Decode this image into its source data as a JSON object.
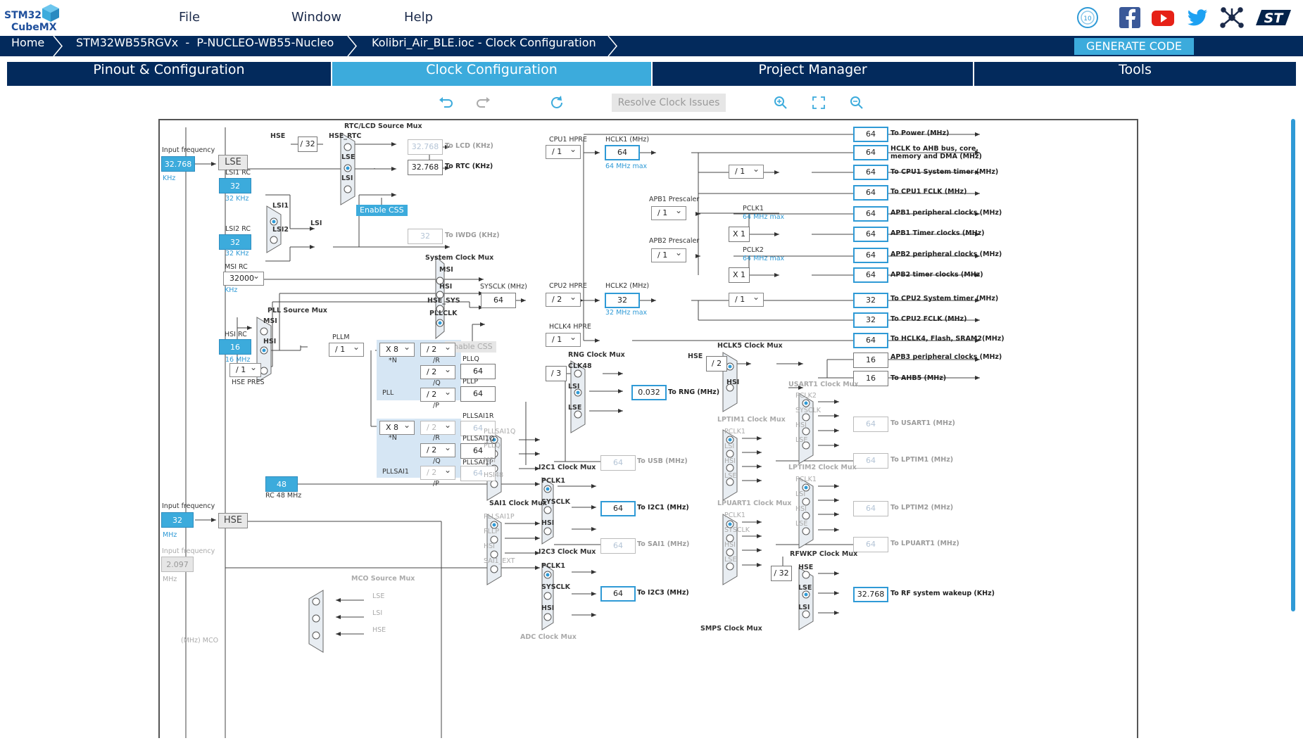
{
  "app": {
    "logo_top": "STM32",
    "logo_bottom": "CubeMX"
  },
  "menu": {
    "file": "File",
    "window": "Window",
    "help": "Help"
  },
  "social": [
    "anniversary-badge-icon",
    "facebook-icon",
    "youtube-icon",
    "twitter-icon",
    "network-icon",
    "st-logo-icon"
  ],
  "breadcrumb": {
    "home": "Home",
    "mcu": "STM32WB55RGVx",
    "board": "P-NUCLEO-WB55-Nucleo",
    "file": "Kolibri_Air_BLE.ioc - Clock Configuration"
  },
  "generate_code": "GENERATE CODE",
  "tabs": {
    "pinout": "Pinout & Configuration",
    "clock": "Clock Configuration",
    "project": "Project Manager",
    "tools": "Tools"
  },
  "toolbar": {
    "resolve": "Resolve Clock Issues"
  },
  "diagram": {
    "input_freq_label": "Input frequency",
    "lse_value": "32.768",
    "lse_unit": "KHz",
    "lse_btn": "LSE",
    "lsi1_rc": "LSI1 RC",
    "lsi1_value": "32",
    "lsi1_unit": "32 KHz",
    "lsi2_rc": "LSI2 RC",
    "lsi2_value": "32",
    "lsi2_unit": "32 KHz",
    "lsi1": "LSI1",
    "lsi2": "LSI2",
    "lsi": "LSI",
    "rtc_mux_title": "RTC/LCD Source Mux",
    "hse": "HSE",
    "hse_div": "/ 32",
    "hse_rtc": "HSE_RTC",
    "lse": "LSE",
    "lcd_value": "32.768",
    "lcd_label": "To LCD (KHz)",
    "rtc_value": "32.768",
    "rtc_label": "To RTC (KHz)",
    "enable_css": "Enable CSS",
    "iwdg_value": "32",
    "iwdg_label": "To IWDG (KHz)",
    "msi_rc": "MSI RC",
    "msi_value": "32000",
    "msi_unit": "KHz",
    "sysclk_mux_title": "System Clock Mux",
    "msi": "MSI",
    "hsi": "HSI",
    "hse_sys": "HSE_SYS",
    "pllclk": "PLLCLK",
    "sysclk_label": "SYSCLK (MHz)",
    "sysclk_value": "64",
    "pll_source_mux": "PLL Source Mux",
    "hsi_rc": "HSI RC",
    "hsi_value": "16",
    "hsi_unit": "16 MHz",
    "hse_pres_value": "/ 1",
    "hse_pres": "HSE PRES",
    "pllm": "PLLM",
    "pllm_value": "/ 1",
    "pll_n_value": "X 8",
    "pll_n": "*N",
    "pll_r_value": "/ 2",
    "pll_r": "/R",
    "pll_q_value": "/ 2",
    "pll_q": "/Q",
    "pll_p_value": "/ 2",
    "pll_p": "/P",
    "pll": "PLL",
    "pllq": "PLLQ",
    "pllq_value": "64",
    "pllp": "PLLP",
    "pllp_value": "64",
    "sai_n_value": "X 8",
    "sai_r_value": "/ 2",
    "sai_q_value": "/ 2",
    "sai_p_value": "/ 2",
    "pllsai1": "PLLSAI1",
    "pllsai1r": "PLLSAI1R",
    "pllsai1r_value": "64",
    "pllsai1q": "PLLSAI1Q",
    "pllsai1q_value": "64",
    "pllsai1p": "PLLSAI1P",
    "pllsai1p_value": "64",
    "rc48_value": "48",
    "rc48": "RC 48 MHz",
    "hse_input_value": "32",
    "hse_unit": "MHz",
    "hse_btn": "HSE",
    "ext_input_label": "Input frequency",
    "ext_value": "2.097",
    "ext_unit": "MHz",
    "mco_mux": "MCO Source Mux",
    "cpu1_hpre": "CPU1 HPRE",
    "cpu1_hpre_value": "/ 1",
    "hclk1": "HCLK1 (MHz)",
    "hclk1_value": "64",
    "hclk1_max": "64 MHz max",
    "apb1_prescaler": "APB1 Prescaler",
    "apb1_value": "/ 1",
    "pclk1": "PCLK1",
    "pclk1_max": "64 MHz max",
    "x1": "X 1",
    "apb2_prescaler": "APB2 Prescaler",
    "apb2_value": "/ 1",
    "pclk2": "PCLK2",
    "pclk2_max": "64 MHz max",
    "sys_timer_div": "/ 1",
    "cpu2_hpre": "CPU2 HPRE",
    "cpu2_hpre_value": "/ 2",
    "hclk2": "HCLK2 (MHz)",
    "hclk2_value": "32",
    "hclk2_max": "32 MHz max",
    "cpu2_timer_div": "/ 1",
    "hclk4_hpre": "HCLK4 HPRE",
    "hclk4_value": "/ 1",
    "outputs": [
      {
        "value": "64",
        "label": "To Power (MHz)"
      },
      {
        "value": "64",
        "label": "HCLK to AHB bus, core,",
        "label2": "memory and DMA (MHz)"
      },
      {
        "value": "64",
        "label": "To CPU1 System timer (MHz)"
      },
      {
        "value": "64",
        "label": "To CPU1 FCLK (MHz)"
      },
      {
        "value": "64",
        "label": "APB1 peripheral clocks (MHz)"
      },
      {
        "value": "64",
        "label": "APB1 Timer clocks (MHz)"
      },
      {
        "value": "64",
        "label": "APB2 peripheral clocks (MHz)"
      },
      {
        "value": "64",
        "label": "APB2 timer clocks (MHz)"
      },
      {
        "value": "32",
        "label": "To CPU2 System timer (MHz)"
      },
      {
        "value": "32",
        "label": "To CPU2 FCLK (MHz)"
      },
      {
        "value": "64",
        "label": "To HCLK4, Flash, SRAM2(MHz)"
      },
      {
        "value": "16",
        "label": "APB3 peripheral clocks (MHz)"
      },
      {
        "value": "16",
        "label": "To AHB5 (MHz)"
      }
    ],
    "hclk5_mux": "HCLK5 Clock Mux",
    "hclk5_hse_div": "/ 2",
    "rng_mux": "RNG Clock Mux",
    "rng_div": "/ 3",
    "clk48": "CLK48",
    "rng_value": "0.032",
    "rng_label": "To RNG (MHz)",
    "usb_value": "64",
    "usb_label": "To USB (MHz)",
    "i2c1_mux": "I2C1 Clock Mux",
    "i2c1_value": "64",
    "i2c1_label": "To I2C1 (MHz)",
    "pclk1_in": "PCLK1",
    "sysclk_in": "SYSCLK",
    "hsi_in": "HSI",
    "pllsai1q_in": "PLLSAI1Q",
    "pllq_in": "PLLQ",
    "msi_in": "MSI",
    "hsi48_in": "HSI48",
    "sai1_mux": "SAI1 Clock Mux",
    "sai1p_in": "PLLSAI1P",
    "pllp_in": "PLLP",
    "sai1_ext": "SAI1_EXT",
    "sai1_value": "64",
    "sai1_label": "To SAI1 (MHz)",
    "i2c3_mux": "I2C3 Clock Mux",
    "i2c3_value": "64",
    "i2c3_label": "To I2C3 (MHz)",
    "adc_mux": "ADC Clock Mux",
    "usart1_mux": "USART1 Clock Mux",
    "usart1_value": "64",
    "usart1_label": "To USART1 (MHz)",
    "pclk2_in": "PCLK2",
    "lse_in": "LSE",
    "lsi_in": "LSI",
    "lptim1_mux": "LPTIM1 Clock Mux",
    "lptim1_value": "64",
    "lptim1_label": "To LPTIM1 (MHz)",
    "lptim2_mux": "LPTIM2 Clock Mux",
    "lptim2_value": "64",
    "lptim2_label": "To LPTIM2 (MHz)",
    "lpuart1_mux": "LPUART1 Clock Mux",
    "lpuart1_value": "64",
    "lpuart1_label": "To LPUART1 (MHz)",
    "rfwkp_mux": "RFWKP Clock Mux",
    "rfwkp_div": "/ 32",
    "rfwkp_value": "32.768",
    "rfwkp_label": "To RF system wakeup (KHz)",
    "smps_mux": "SMPS Clock Mux",
    "mco_out": "(MHz) MCO"
  },
  "colors": {
    "navy": "#032a5c",
    "accent": "#3cabdc",
    "blue_border": "#2f9ad6"
  }
}
